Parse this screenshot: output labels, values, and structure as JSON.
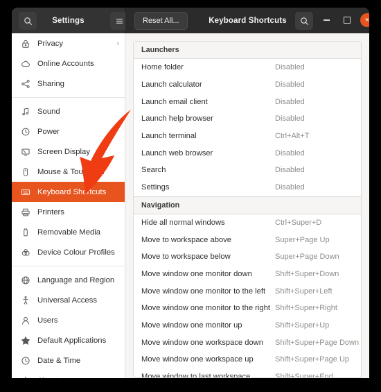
{
  "window": {
    "sidebar_title": "Settings",
    "content_title": "Keyboard Shortcuts",
    "reset_all_label": "Reset All...",
    "search_icon": "search-icon",
    "menu_icon": "hamburger-menu-icon",
    "minimize_label": "",
    "maximize_label": "",
    "close_label": "×",
    "accent_color": "#e8541e",
    "headerbar_color": "#2b2b2b",
    "sidebar_header_color": "#333333"
  },
  "sidebar": {
    "items": [
      {
        "label": "Privacy",
        "icon": "lock-icon",
        "chevron": "›",
        "selected": false
      },
      {
        "label": "Online Accounts",
        "icon": "cloud-icon",
        "chevron": "",
        "selected": false
      },
      {
        "label": "Sharing",
        "icon": "share-nodes-icon",
        "chevron": "",
        "selected": false
      },
      {
        "separator": true
      },
      {
        "label": "Sound",
        "icon": "music-note-icon",
        "chevron": "",
        "selected": false
      },
      {
        "label": "Power",
        "icon": "power-gauge-icon",
        "chevron": "",
        "selected": false
      },
      {
        "label": "Screen Display",
        "icon": "monitor-icon",
        "chevron": "",
        "selected": false
      },
      {
        "label": "Mouse & Touchpad",
        "icon": "mouse-icon",
        "chevron": "",
        "selected": false
      },
      {
        "label": "Keyboard Shortcuts",
        "icon": "keyboard-icon",
        "chevron": "",
        "selected": true
      },
      {
        "label": "Printers",
        "icon": "printer-icon",
        "chevron": "",
        "selected": false
      },
      {
        "label": "Removable Media",
        "icon": "usb-drive-icon",
        "chevron": "",
        "selected": false
      },
      {
        "label": "Device Colour Profiles",
        "icon": "colour-profile-icon",
        "chevron": "",
        "selected": false
      },
      {
        "separator": true
      },
      {
        "label": "Language and Region",
        "icon": "globe-icon",
        "chevron": "",
        "selected": false
      },
      {
        "label": "Universal Access",
        "icon": "accessibility-icon",
        "chevron": "",
        "selected": false
      },
      {
        "label": "Users",
        "icon": "user-icon",
        "chevron": "",
        "selected": false
      },
      {
        "label": "Default Applications",
        "icon": "star-icon",
        "chevron": "",
        "selected": false
      },
      {
        "label": "Date & Time",
        "icon": "clock-icon",
        "chevron": "",
        "selected": false
      },
      {
        "label": "About",
        "icon": "sparkle-icon",
        "chevron": "",
        "selected": false
      }
    ]
  },
  "shortcuts": {
    "groups": [
      {
        "title": "Launchers",
        "rows": [
          {
            "name": "Home folder",
            "accel": "Disabled"
          },
          {
            "name": "Launch calculator",
            "accel": "Disabled"
          },
          {
            "name": "Launch email client",
            "accel": "Disabled"
          },
          {
            "name": "Launch help browser",
            "accel": "Disabled"
          },
          {
            "name": "Launch terminal",
            "accel": "Ctrl+Alt+T"
          },
          {
            "name": "Launch web browser",
            "accel": "Disabled"
          },
          {
            "name": "Search",
            "accel": "Disabled"
          },
          {
            "name": "Settings",
            "accel": "Disabled"
          }
        ]
      },
      {
        "title": "Navigation",
        "rows": [
          {
            "name": "Hide all normal windows",
            "accel": "Ctrl+Super+D"
          },
          {
            "name": "Move to workspace above",
            "accel": "Super+Page Up"
          },
          {
            "name": "Move to workspace below",
            "accel": "Super+Page Down"
          },
          {
            "name": "Move window one monitor down",
            "accel": "Shift+Super+Down"
          },
          {
            "name": "Move window one monitor to the left",
            "accel": "Shift+Super+Left"
          },
          {
            "name": "Move window one monitor to the right",
            "accel": "Shift+Super+Right"
          },
          {
            "name": "Move window one monitor up",
            "accel": "Shift+Super+Up"
          },
          {
            "name": "Move window one workspace down",
            "accel": "Shift+Super+Page Down"
          },
          {
            "name": "Move window one workspace up",
            "accel": "Shift+Super+Page Up"
          },
          {
            "name": "Move window to last workspace",
            "accel": "Shift+Super+End"
          }
        ]
      }
    ]
  },
  "annotation": {
    "arrow_color": "#f03c13",
    "points_to": "Keyboard Shortcuts"
  }
}
